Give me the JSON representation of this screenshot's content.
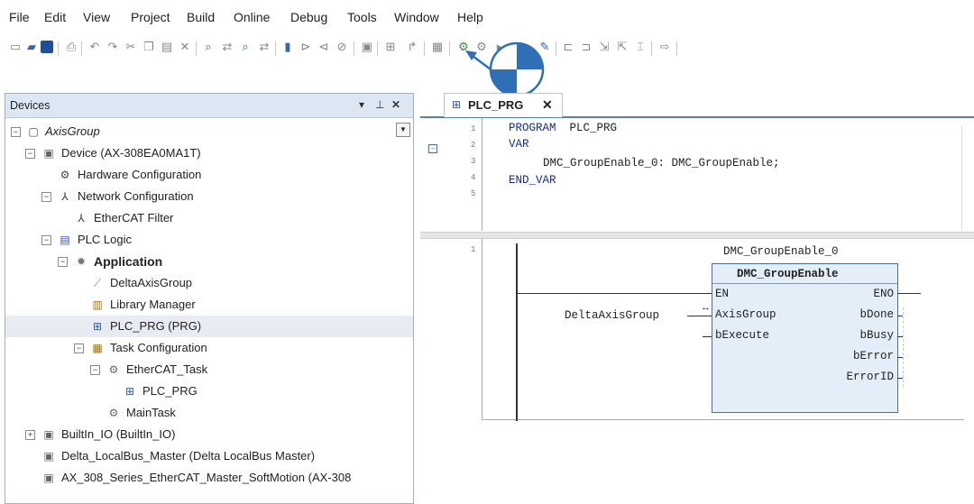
{
  "menu": [
    "File",
    "Edit",
    "View",
    "Project",
    "Build",
    "Online",
    "Debug",
    "Tools",
    "Window",
    "Help"
  ],
  "toolbar_icons": [
    "new-project-icon",
    "open-project-icon",
    "save-icon",
    "print-icon",
    "undo-icon",
    "redo-icon",
    "cut-icon",
    "copy-icon",
    "paste-icon",
    "delete-icon",
    "find-icon",
    "find-replace-icon",
    "find-in-project-icon",
    "replace-in-project-icon",
    "bookmark-icon",
    "bookmark-next-icon",
    "bookmark-prev-icon",
    "bookmark-clear-icon",
    "device-icon",
    "add-object-icon",
    "insert-icon",
    "build-icon",
    "login-icon",
    "logout-icon",
    "start-icon",
    "stop-icon",
    "reset-icon",
    "breakpoint-icon",
    "step-over-icon",
    "step-into-icon",
    "step-out-icon",
    "cursor-icon",
    "forward-icon"
  ],
  "devices": {
    "title": "Devices",
    "tree": [
      {
        "label": "AxisGroup",
        "italic": true
      },
      {
        "label": "Device (AX-308EA0MA1T)"
      },
      {
        "label": "Hardware Configuration"
      },
      {
        "label": "Network Configuration"
      },
      {
        "label": "EtherCAT Filter"
      },
      {
        "label": "PLC Logic"
      },
      {
        "label": "Application",
        "bold": true
      },
      {
        "label": "DeltaAxisGroup"
      },
      {
        "label": "Library Manager"
      },
      {
        "label": "PLC_PRG (PRG)"
      },
      {
        "label": "Task Configuration"
      },
      {
        "label": "EtherCAT_Task"
      },
      {
        "label": "PLC_PRG"
      },
      {
        "label": "MainTask"
      },
      {
        "label": "BuiltIn_IO (BuiltIn_IO)"
      },
      {
        "label": "Delta_LocalBus_Master (Delta LocalBus Master)"
      },
      {
        "label": "AX_308_Series_EtherCAT_Master_SoftMotion (AX-308"
      }
    ]
  },
  "editor": {
    "tab_title": "PLC_PRG",
    "line_numbers": [
      "1",
      "2",
      "3",
      "4",
      "5"
    ],
    "decl": {
      "l1_kw": "PROGRAM",
      "l1_name": " PLC_PRG",
      "l2": "VAR",
      "l3": "DMC_GroupEnable_0: DMC_GroupEnable;",
      "l4": "END_VAR"
    },
    "body_line": "1",
    "fb": {
      "instance": "DMC_GroupEnable_0",
      "type": "DMC_GroupEnable",
      "in_en": "EN",
      "in_axis": "AxisGroup",
      "in_exec": "bExecute",
      "out_eno": "ENO",
      "out_done": "bDone",
      "out_busy": "bBusy",
      "out_error": "bError",
      "out_errid": "ErrorID",
      "axis_var": "DeltaAxisGroup",
      "inout_marker": "↔"
    }
  }
}
